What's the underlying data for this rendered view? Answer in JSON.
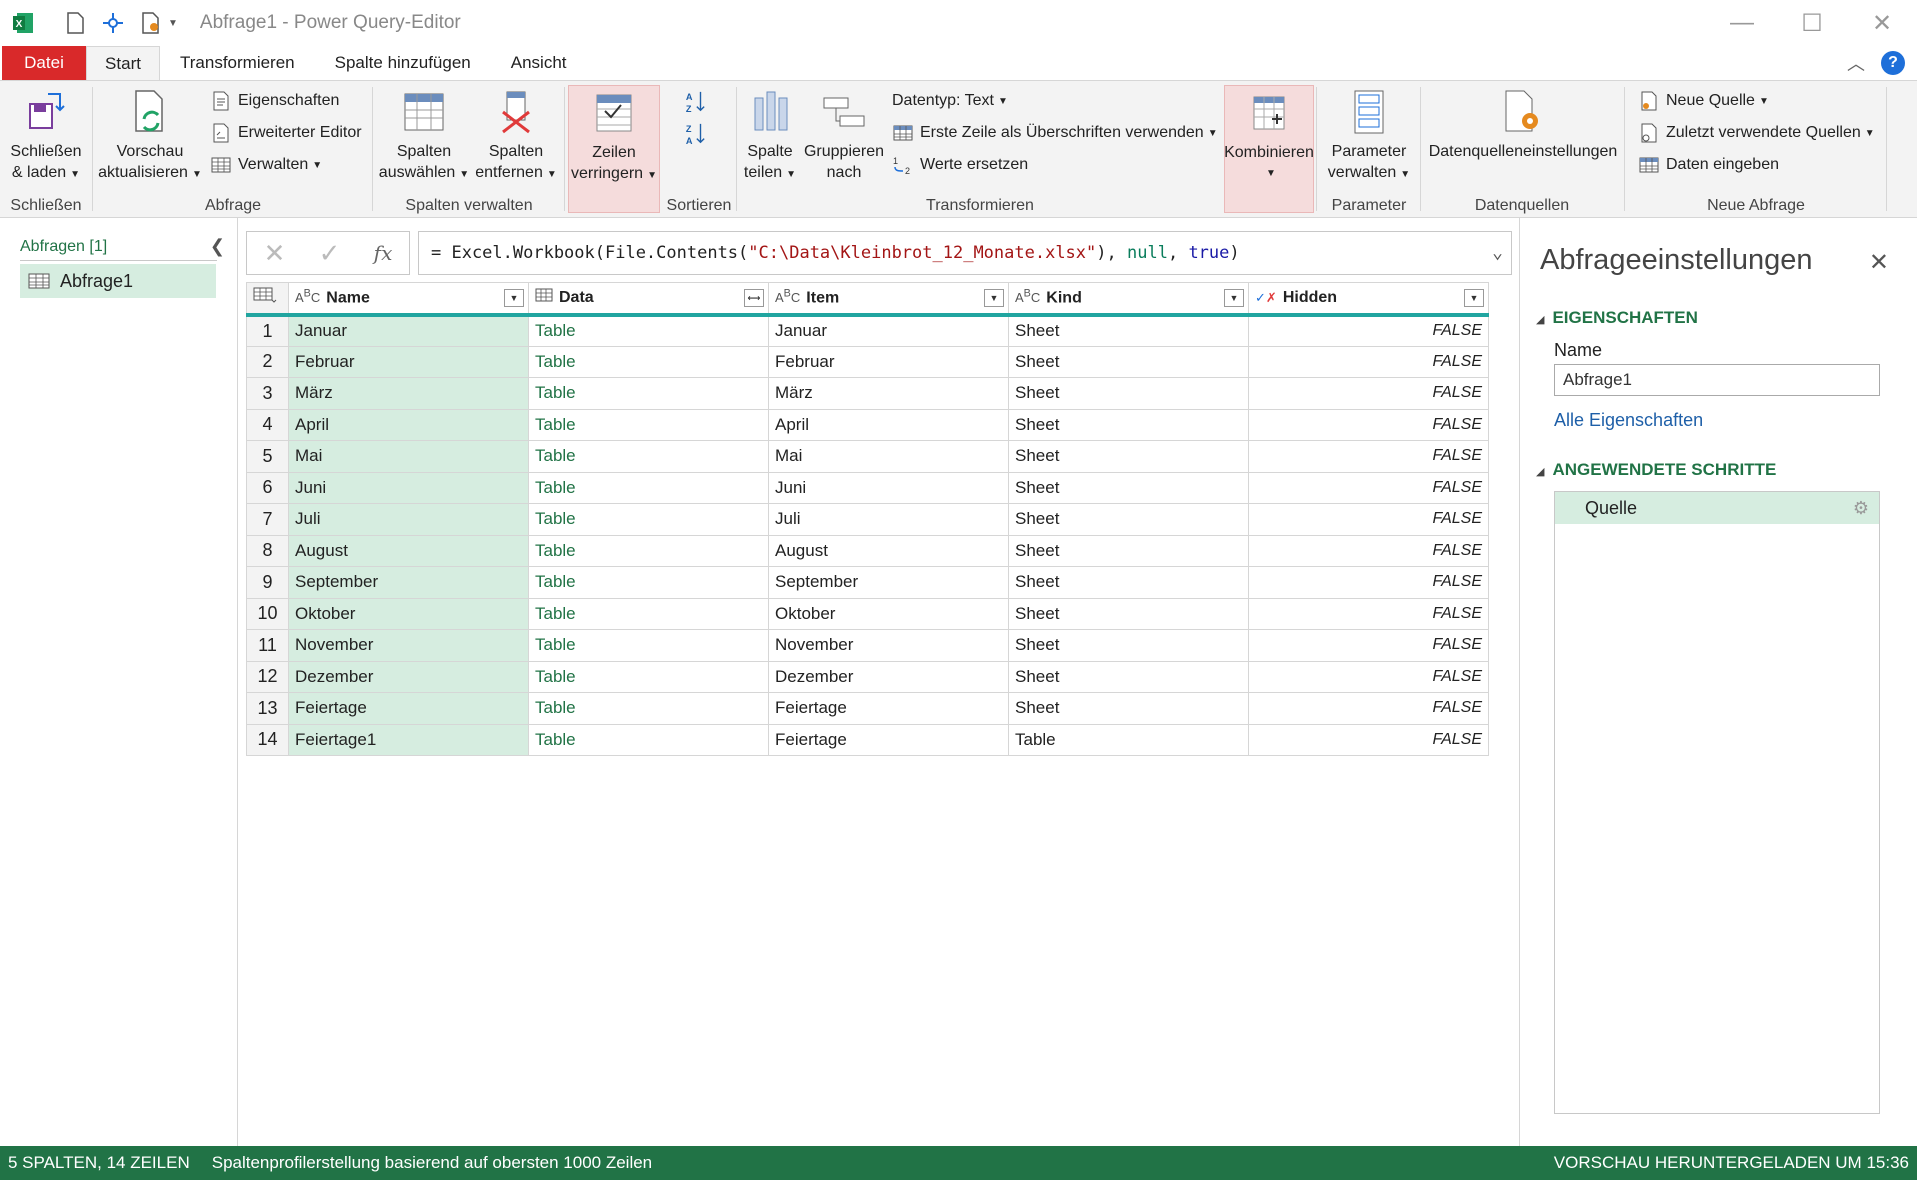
{
  "window": {
    "title": "Abfrage1 - Power Query-Editor",
    "minimize": "—",
    "maximize": "☐",
    "close": "✕"
  },
  "tabs": [
    "Datei",
    "Start",
    "Transformieren",
    "Spalte hinzufügen",
    "Ansicht"
  ],
  "ribbon": {
    "schliessen": {
      "btn1": "Schließen",
      "btn2": "& laden",
      "group": "Schließen"
    },
    "abfrage": {
      "vorschau1": "Vorschau",
      "vorschau2": "aktualisieren",
      "eigenschaften": "Eigenschaften",
      "editor": "Erweiterter Editor",
      "verwalten": "Verwalten",
      "group": "Abfrage"
    },
    "spalten": {
      "auswaehlen1": "Spalten",
      "auswaehlen2": "auswählen",
      "entfernen1": "Spalten",
      "entfernen2": "entfernen",
      "group": "Spalten verwalten"
    },
    "zeilen": {
      "btn1": "Zeilen",
      "btn2": "verringern"
    },
    "sortieren": {
      "group": "Sortieren"
    },
    "transformieren": {
      "teilen1": "Spalte",
      "teilen2": "teilen",
      "gruppieren1": "Gruppieren",
      "gruppieren2": "nach",
      "datentyp": "Datentyp: Text",
      "erstezeile": "Erste Zeile als Überschriften verwenden",
      "werte": "Werte ersetzen",
      "group": "Transformieren"
    },
    "kombinieren": {
      "btn1": "Kombinieren"
    },
    "parameter": {
      "btn1": "Parameter",
      "btn2": "verwalten",
      "group": "Parameter"
    },
    "datenquellen": {
      "btn1": "Datenquelleneinstellungen",
      "group": "Datenquellen"
    },
    "neueabfrage": {
      "neuequelle": "Neue Quelle",
      "zuletzt": "Zuletzt verwendete Quellen",
      "daten": "Daten eingeben",
      "group": "Neue Abfrage"
    }
  },
  "queries": {
    "header": "Abfragen [1]",
    "items": [
      "Abfrage1"
    ]
  },
  "formula": {
    "prefix": "= Excel.Workbook(File.Contents(",
    "path": "\"C:\\Data\\Kleinbrot_12_Monate.xlsx\"",
    "mid": "), ",
    "null": "null",
    "comma": ", ",
    "true": "true",
    "suffix": ")"
  },
  "grid": {
    "columns": [
      {
        "name": "Name",
        "type": "ABC"
      },
      {
        "name": "Data",
        "type": "table"
      },
      {
        "name": "Item",
        "type": "ABC"
      },
      {
        "name": "Kind",
        "type": "ABC"
      },
      {
        "name": "Hidden",
        "type": "bool"
      }
    ],
    "rows": [
      [
        "1",
        "Januar",
        "Table",
        "Januar",
        "Sheet",
        "FALSE"
      ],
      [
        "2",
        "Februar",
        "Table",
        "Februar",
        "Sheet",
        "FALSE"
      ],
      [
        "3",
        "März",
        "Table",
        "März",
        "Sheet",
        "FALSE"
      ],
      [
        "4",
        "April",
        "Table",
        "April",
        "Sheet",
        "FALSE"
      ],
      [
        "5",
        "Mai",
        "Table",
        "Mai",
        "Sheet",
        "FALSE"
      ],
      [
        "6",
        "Juni",
        "Table",
        "Juni",
        "Sheet",
        "FALSE"
      ],
      [
        "7",
        "Juli",
        "Table",
        "Juli",
        "Sheet",
        "FALSE"
      ],
      [
        "8",
        "August",
        "Table",
        "August",
        "Sheet",
        "FALSE"
      ],
      [
        "9",
        "September",
        "Table",
        "September",
        "Sheet",
        "FALSE"
      ],
      [
        "10",
        "Oktober",
        "Table",
        "Oktober",
        "Sheet",
        "FALSE"
      ],
      [
        "11",
        "November",
        "Table",
        "November",
        "Sheet",
        "FALSE"
      ],
      [
        "12",
        "Dezember",
        "Table",
        "Dezember",
        "Sheet",
        "FALSE"
      ],
      [
        "13",
        "Feiertage",
        "Table",
        "Feiertage",
        "Sheet",
        "FALSE"
      ],
      [
        "14",
        "Feiertage1",
        "Table",
        "Feiertage",
        "Table",
        "FALSE"
      ]
    ]
  },
  "settings": {
    "title": "Abfrageeinstellungen",
    "properties_header": "EIGENSCHAFTEN",
    "name_label": "Name",
    "name_value": "Abfrage1",
    "all_properties": "Alle Eigenschaften",
    "steps_header": "ANGEWENDETE SCHRITTE",
    "steps": [
      "Quelle"
    ]
  },
  "status": {
    "left": "5 SPALTEN, 14 ZEILEN",
    "mid": "Spaltenprofilerstellung basierend auf obersten 1000 Zeilen",
    "right": "VORSCHAU HERUNTERGELADEN UM 15:36"
  },
  "colors": {
    "accent_green": "#217346",
    "file_tab_red": "#d9292a",
    "selection_green": "#d6ede0",
    "header_teal": "#21a5a0"
  }
}
